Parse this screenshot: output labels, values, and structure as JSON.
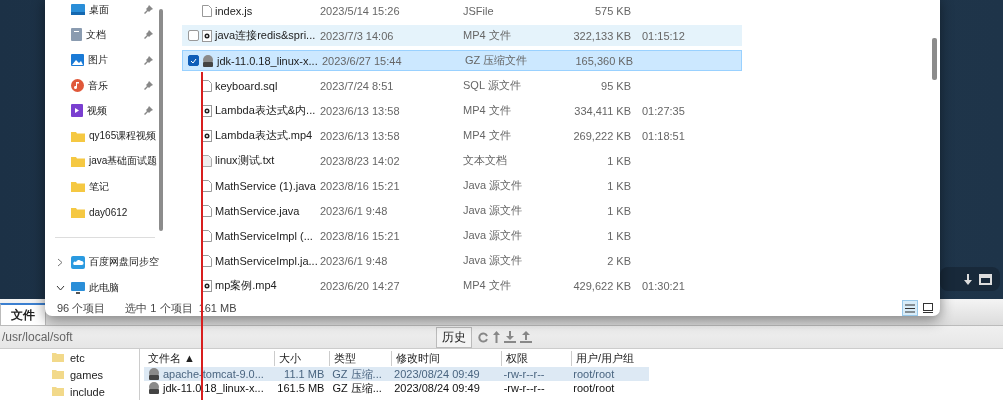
{
  "explorer": {
    "sidebar": {
      "items": [
        {
          "label": "桌面",
          "kind": "desktop",
          "pinned": true
        },
        {
          "label": "文档",
          "kind": "documents",
          "pinned": true
        },
        {
          "label": "图片",
          "kind": "pictures",
          "pinned": true
        },
        {
          "label": "音乐",
          "kind": "music",
          "pinned": true
        },
        {
          "label": "视频",
          "kind": "videos",
          "pinned": true
        },
        {
          "label": "qy165课程视频",
          "kind": "folder",
          "pinned": false
        },
        {
          "label": "java基础面试题",
          "kind": "folder",
          "pinned": false
        },
        {
          "label": "笔记",
          "kind": "folder",
          "pinned": false
        },
        {
          "label": "day0612",
          "kind": "folder",
          "pinned": false
        }
      ],
      "locations": [
        {
          "label": "百度网盘同步空",
          "kind": "cloud",
          "pinned": false,
          "expanded": false
        },
        {
          "label": "此电脑",
          "kind": "computer",
          "pinned": false,
          "expanded": true
        }
      ]
    },
    "files": [
      {
        "name": "index.js",
        "modified": "2023/5/14 15:26",
        "type": "JSFile",
        "size": "575 KB",
        "kind": "file",
        "hovered": false,
        "selected": false
      },
      {
        "name": "java连接redis&spri...",
        "modified": "2023/7/3 14:06",
        "type": "MP4 文件",
        "size": "322,133 KB",
        "duration": "01:15:12",
        "kind": "video",
        "hovered": true,
        "selected": false
      },
      {
        "name": "jdk-11.0.18_linux-x...",
        "modified": "2023/6/27 15:44",
        "type": "GZ 压缩文件",
        "size": "165,360 KB",
        "kind": "archive",
        "hovered": false,
        "selected": true
      },
      {
        "name": "keyboard.sql",
        "modified": "2023/7/24 8:51",
        "type": "SQL 源文件",
        "size": "95 KB",
        "kind": "file",
        "hovered": false,
        "selected": false
      },
      {
        "name": "Lambda表达式&内...",
        "modified": "2023/6/13 13:58",
        "type": "MP4 文件",
        "size": "334,411 KB",
        "duration": "01:27:35",
        "kind": "video",
        "hovered": false,
        "selected": false
      },
      {
        "name": "Lambda表达式.mp4",
        "modified": "2023/6/13 13:58",
        "type": "MP4 文件",
        "size": "269,222 KB",
        "duration": "01:18:51",
        "kind": "video",
        "hovered": false,
        "selected": false
      },
      {
        "name": "linux测试.txt",
        "modified": "2023/8/23 14:02",
        "type": "文本文档",
        "size": "1 KB",
        "kind": "text",
        "hovered": false,
        "selected": false
      },
      {
        "name": "MathService (1).java",
        "modified": "2023/8/16 15:21",
        "type": "Java 源文件",
        "size": "1 KB",
        "kind": "file",
        "hovered": false,
        "selected": false
      },
      {
        "name": "MathService.java",
        "modified": "2023/6/1 9:48",
        "type": "Java 源文件",
        "size": "1 KB",
        "kind": "file",
        "hovered": false,
        "selected": false
      },
      {
        "name": "MathServiceImpl (...",
        "modified": "2023/8/16 15:21",
        "type": "Java 源文件",
        "size": "1 KB",
        "kind": "file",
        "hovered": false,
        "selected": false
      },
      {
        "name": "MathServiceImpl.ja...",
        "modified": "2023/6/1 9:48",
        "type": "Java 源文件",
        "size": "2 KB",
        "kind": "file",
        "hovered": false,
        "selected": false
      },
      {
        "name": "mp案例.mp4",
        "modified": "2023/6/20 14:27",
        "type": "MP4 文件",
        "size": "429,622 KB",
        "duration": "01:30:21",
        "kind": "video",
        "hovered": false,
        "selected": false
      }
    ],
    "status_bar": {
      "count": "96 个项目",
      "selection": "选中 1 个项目  161 MB"
    },
    "view_buttons": [
      {
        "kind": "details",
        "selected": true
      },
      {
        "kind": "tiles",
        "selected": false
      }
    ]
  },
  "sftp": {
    "tabs": [
      {
        "label": "文件",
        "selected": true
      }
    ],
    "path": "/usr/local/soft",
    "history_button": "历史",
    "tree": [
      "etc",
      "games",
      "include"
    ],
    "columns": [
      "文件名 ▲",
      "大小",
      "类型",
      "修改时间",
      "权限",
      "用户/用户组"
    ],
    "rows": [
      {
        "cells": [
          "apache-tomcat-9.0...",
          "11.1 MB",
          "GZ 压缩...",
          "2023/08/24 09:49",
          "-rw-r--r--",
          "root/root"
        ],
        "selected": true
      },
      {
        "cells": [
          "jdk-11.0.18_linux-x...",
          "161.5 MB",
          "GZ 压缩...",
          "2023/08/24 09:49",
          "-rw-r--r--",
          "root/root"
        ],
        "selected": false
      }
    ]
  }
}
